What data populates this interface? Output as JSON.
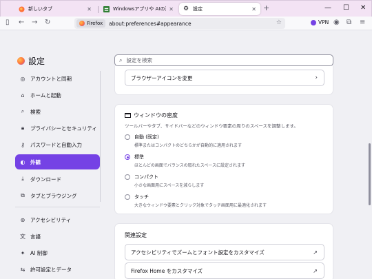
{
  "tabs": [
    {
      "label": "新しいタブ"
    },
    {
      "label": "Windowsアプリや AIの活用法、損"
    },
    {
      "label": "設定"
    }
  ],
  "new_tab": "+",
  "window_controls": {
    "minimize": "—",
    "maximize": "☐",
    "close": "✕"
  },
  "toolbar": {
    "identity_label": "Firefox",
    "url": "about:preferences#appearance",
    "vpn_label": "VPN"
  },
  "sidebar": {
    "title": "設定",
    "items": [
      {
        "label": "アカウントと同期",
        "icon": "account-icon"
      },
      {
        "label": "ホームと起動",
        "icon": "home-icon"
      },
      {
        "label": "検索",
        "icon": "search-icon"
      },
      {
        "label": "プライバシーとセキュリティ",
        "icon": "lock-icon"
      },
      {
        "label": "パスワードと自動入力",
        "icon": "key-icon"
      },
      {
        "label": "外観",
        "icon": "palette-icon",
        "active": true
      },
      {
        "label": "ダウンロード",
        "icon": "download-icon"
      },
      {
        "label": "タブとブラウジング",
        "icon": "tabs-icon"
      }
    ],
    "items_bottom": [
      {
        "label": "アクセシビリティ",
        "icon": "accessibility-icon"
      },
      {
        "label": "言語",
        "icon": "language-icon"
      },
      {
        "label": "AI 制御",
        "icon": "ai-icon"
      },
      {
        "label": "許可設定とデータ",
        "icon": "permissions-icon"
      }
    ]
  },
  "search": {
    "placeholder": "設定を検索"
  },
  "browser_icon_card": {
    "button_label": "ブラウザーアイコンを変更"
  },
  "density_card": {
    "title": "ウィンドウの密度",
    "description": "ツールバーやタブ、サイドバーなどのウィンドウ要素の周りのスペースを調整します。",
    "options": [
      {
        "label": "自動 (既定)",
        "desc": "標準またはコンパクトのどちらかが自動的に適用されます",
        "checked": false
      },
      {
        "label": "標準",
        "desc": "ほとんどの画面でバランスの取れたスペースに設定されます",
        "checked": true
      },
      {
        "label": "コンパクト",
        "desc": "小さな画面用にスペースを減らします",
        "checked": false
      },
      {
        "label": "タッチ",
        "desc": "大きなウィンドウ要素とクリック対象でタッチ画面用に最適化されます",
        "checked": false
      }
    ]
  },
  "related_card": {
    "title": "関連設定",
    "links": [
      {
        "label": "アクセシビリティでズームとフォント設定をカスタマイズ"
      },
      {
        "label": "Firefox Home をカスタマイズ"
      }
    ]
  },
  "colors": {
    "accent": "#7542e5",
    "tabstrip": "#f3e3f4"
  }
}
